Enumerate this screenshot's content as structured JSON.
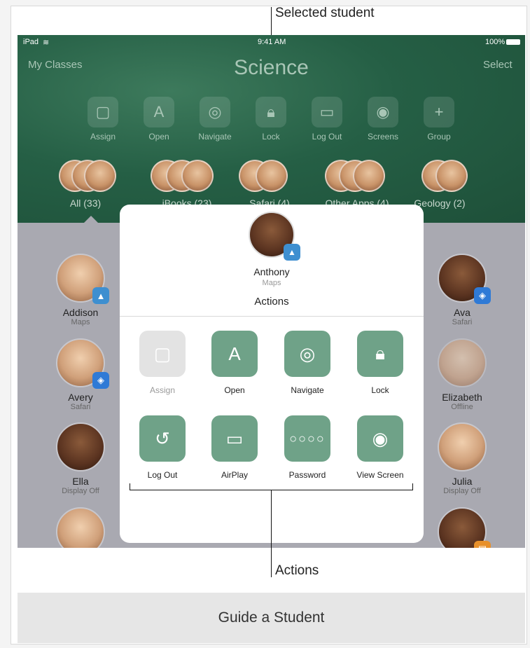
{
  "callouts": {
    "selected_student": "Selected student",
    "actions": "Actions"
  },
  "status_bar": {
    "device": "iPad",
    "time": "9:41 AM",
    "battery": "100%"
  },
  "nav": {
    "back": "My Classes",
    "title": "Science",
    "select": "Select"
  },
  "toolbar": [
    {
      "label": "Assign",
      "icon": "assign-icon"
    },
    {
      "label": "Open",
      "icon": "app-store-icon"
    },
    {
      "label": "Navigate",
      "icon": "compass-icon"
    },
    {
      "label": "Lock",
      "icon": "lock-icon"
    },
    {
      "label": "Log Out",
      "icon": "logout-icon"
    },
    {
      "label": "Screens",
      "icon": "screens-icon"
    },
    {
      "label": "Group",
      "icon": "plus-icon"
    }
  ],
  "groups": [
    {
      "label": "All (33)"
    },
    {
      "label": "iBooks (23)"
    },
    {
      "label": "Safari (4)"
    },
    {
      "label": "Other Apps (4)"
    },
    {
      "label": "Geology (2)"
    }
  ],
  "students_left": [
    {
      "name": "Addison",
      "status": "Maps"
    },
    {
      "name": "Avery",
      "status": "Safari"
    },
    {
      "name": "Ella",
      "status": "Display Off"
    }
  ],
  "students_right": [
    {
      "name": "Ava",
      "status": "Safari"
    },
    {
      "name": "Elizabeth",
      "status": "Offline"
    },
    {
      "name": "Julia",
      "status": "Display Off"
    }
  ],
  "popover": {
    "student_name": "Anthony",
    "student_status": "Maps",
    "heading": "Actions",
    "actions": [
      {
        "label": "Assign",
        "icon": "assign-icon",
        "enabled": false
      },
      {
        "label": "Open",
        "icon": "app-store-icon",
        "enabled": true
      },
      {
        "label": "Navigate",
        "icon": "compass-icon",
        "enabled": true
      },
      {
        "label": "Lock",
        "icon": "lock-icon",
        "enabled": true
      },
      {
        "label": "Log Out",
        "icon": "logout-icon",
        "enabled": true
      },
      {
        "label": "AirPlay",
        "icon": "airplay-icon",
        "enabled": true
      },
      {
        "label": "Password",
        "icon": "password-icon",
        "enabled": true
      },
      {
        "label": "View Screen",
        "icon": "view-screen-icon",
        "enabled": true
      }
    ]
  },
  "caption": "Guide a Student",
  "colors": {
    "header_green": "#255f45",
    "action_green": "#6fa288",
    "disabled": "#e3e3e3"
  }
}
